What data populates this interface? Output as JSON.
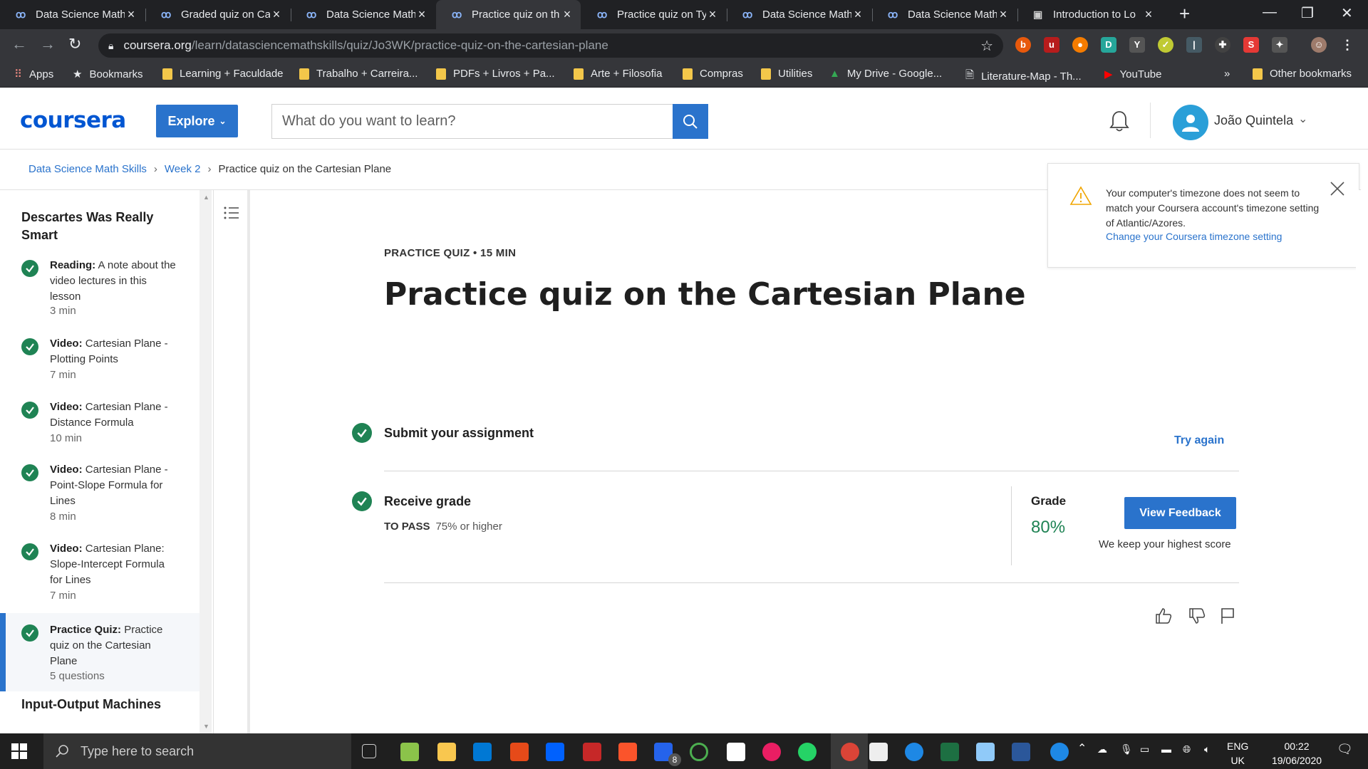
{
  "browser": {
    "tabs": [
      {
        "title": "Data Science Math"
      },
      {
        "title": "Graded quiz on Ca"
      },
      {
        "title": "Data Science Math"
      },
      {
        "title": "Practice quiz on th"
      },
      {
        "title": "Practice quiz on Ty"
      },
      {
        "title": "Data Science Math"
      },
      {
        "title": "Data Science Math"
      },
      {
        "title": "Introduction to Lo"
      }
    ],
    "url_host": "coursera.org",
    "url_path": "/learn/datasciencemathskills/quiz/Jo3WK/practice-quiz-on-the-cartesian-plane",
    "bookmarks": [
      "Apps",
      "Bookmarks",
      "Learning + Faculdade",
      "Trabalho + Carreira...",
      "PDFs + Livros + Pa...",
      "Arte + Filosofia",
      "Compras",
      "Utilities",
      "My Drive - Google...",
      "Literature-Map - Th...",
      "YouTube"
    ],
    "more": "»",
    "other_bookmarks": "Other bookmarks"
  },
  "header": {
    "logo": "coursera",
    "explore": "Explore",
    "search_placeholder": "What do you want to learn?",
    "username": "João Quintela"
  },
  "breadcrumb": {
    "course": "Data Science Math Skills",
    "week": "Week 2",
    "current": "Practice quiz on the Cartesian Plane"
  },
  "sidebar": {
    "title": "Descartes Was Really Smart",
    "items": [
      {
        "kind": "Reading:",
        "text": " A note about the video lectures in this lesson",
        "dur": "3 min"
      },
      {
        "kind": "Video:",
        "text": " Cartesian Plane - Plotting Points",
        "dur": "7 min"
      },
      {
        "kind": "Video:",
        "text": " Cartesian Plane - Distance Formula",
        "dur": "10 min"
      },
      {
        "kind": "Video:",
        "text": " Cartesian Plane - Point-Slope Formula for Lines",
        "dur": "8 min"
      },
      {
        "kind": "Video:",
        "text": " Cartesian Plane: Slope-Intercept Formula for Lines",
        "dur": "7 min"
      },
      {
        "kind": "Practice Quiz:",
        "text": " Practice quiz on the Cartesian Plane",
        "dur": "5 questions"
      }
    ],
    "next_section": "Input-Output Machines"
  },
  "main": {
    "kicker": "PRACTICE QUIZ • 15 MIN",
    "title": "Practice quiz on the Cartesian Plane",
    "submit_label": "Submit your assignment",
    "try_again": "Try again",
    "receive_label": "Receive grade",
    "to_pass_label": "TO PASS",
    "to_pass_value": "75% or higher",
    "grade_label": "Grade",
    "grade_value": "80%",
    "view_feedback": "View Feedback",
    "keep_note": "We keep your highest score"
  },
  "notice": {
    "message": "Your computer's timezone does not seem to match your Coursera account's timezone setting of Atlantic/Azores.",
    "link": "Change your Coursera timezone setting"
  },
  "taskbar": {
    "search_placeholder": "Type here to search",
    "badge": "8",
    "lang": "ENG",
    "region": "UK",
    "time": "00:22",
    "date": "19/06/2020"
  },
  "colors": {
    "brand": "#0056d2",
    "primary": "#2a73cc",
    "success": "#1f8354"
  }
}
